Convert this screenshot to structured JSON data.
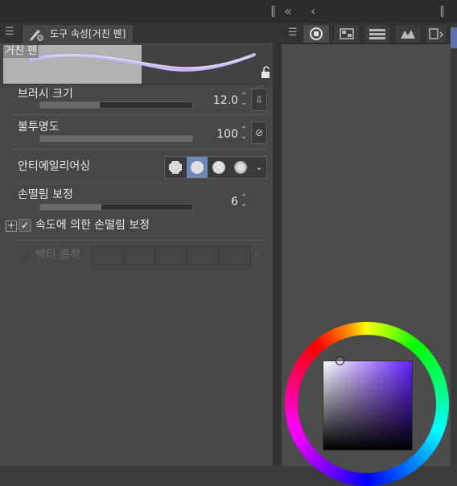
{
  "topbar": {
    "collapse_glyph": "«",
    "back_glyph": "‹",
    "grip_glyph": "‖"
  },
  "left_panel": {
    "tab_title": "도구 속성[거친 펜]",
    "menu_glyph": "☰",
    "preview_name": "거친 펜",
    "lock_glyph": "🔓"
  },
  "properties": {
    "brush_size": {
      "label": "브러시 크기",
      "value": "12.0",
      "level": 0.39,
      "side_icon": "down-arrow-icon"
    },
    "opacity": {
      "label": "불투명도",
      "value": "100",
      "level": 1.0,
      "side_icon": "slash-box-icon"
    },
    "antialias": {
      "label": "안티에일리어싱",
      "options": [
        "none",
        "weak",
        "medium",
        "strong"
      ],
      "selected_index": 1
    },
    "stabilization": {
      "label": "손떨림 보정",
      "value": "6",
      "level": 0.4
    },
    "speed_stabilization": {
      "label": "속도에 의한 손떨림 보정",
      "checked": true
    },
    "vector_snap": {
      "label": "벡터 흡착",
      "enabled": false
    }
  },
  "right_panel": {
    "menu_glyph": "☰",
    "tabs": [
      {
        "icon": "color-wheel-icon",
        "selected": true
      },
      {
        "icon": "color-set-icon",
        "selected": false
      },
      {
        "icon": "color-slider-icon",
        "selected": false
      },
      {
        "icon": "intermediate-color-icon",
        "selected": false
      },
      {
        "icon": "approx-color-icon",
        "selected": false
      }
    ]
  },
  "color": {
    "hue": "#6320ff",
    "saturation": 0.12,
    "value": 0.92
  },
  "colors": {
    "panel_bg": "#474747",
    "header_bg": "#333333",
    "accent_selected": "#6f86b8",
    "stroke_color": "#c8b8ff"
  },
  "spinner_glyph": "⌃⌄",
  "check_glyph": "✓",
  "plus_glyph": "+",
  "dropdown_glyph": "⌄",
  "side_glyphs": {
    "download": "⇩",
    "slash": "⊘"
  }
}
